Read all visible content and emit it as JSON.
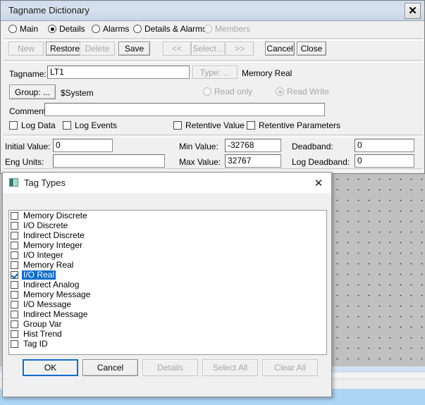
{
  "desktop": {
    "background_color": "#c0c0c0",
    "accent_band_color": "#aed4f5"
  },
  "tagname_window": {
    "title": "Tagname Dictionary",
    "close_label": "✕",
    "view_modes": [
      {
        "label": "Main",
        "selected": false,
        "disabled": false
      },
      {
        "label": "Details",
        "selected": true,
        "disabled": false
      },
      {
        "label": "Alarms",
        "selected": false,
        "disabled": false
      },
      {
        "label": "Details & Alarms",
        "selected": false,
        "disabled": false
      },
      {
        "label": "Members",
        "selected": false,
        "disabled": true
      }
    ],
    "toolbar": [
      {
        "label": "New",
        "disabled": true
      },
      {
        "label": "Restore",
        "disabled": false
      },
      {
        "label": "Delete",
        "disabled": true
      },
      {
        "label": "Save",
        "disabled": false
      },
      {
        "label": "<<",
        "disabled": true
      },
      {
        "label": "Select...",
        "disabled": true
      },
      {
        "label": ">>",
        "disabled": true
      },
      {
        "label": "Cancel",
        "disabled": false
      },
      {
        "label": "Close",
        "disabled": false
      }
    ],
    "fields": {
      "tagname_label": "Tagname:",
      "tagname_value": "LT1",
      "type_button": "Type: ...",
      "type_value": "Memory Real",
      "group_button": "Group: ...",
      "group_value": "$System",
      "access_readonly": "Read only",
      "access_readwrite": "Read Write",
      "comment_label": "Comment:",
      "comment_value": "",
      "log_data": "Log Data",
      "log_events": "Log Events",
      "retentive_value": "Retentive Value",
      "retentive_parameters": "Retentive Parameters",
      "initial_value_label": "Initial Value:",
      "initial_value": "0",
      "eng_units_label": "Eng Units:",
      "eng_units_value": "",
      "min_value_label": "Min Value:",
      "min_value": "-32768",
      "max_value_label": "Max Value:",
      "max_value": "32767",
      "deadband_label": "Deadband:",
      "deadband_value": "0",
      "log_deadband_label": "Log Deadband:",
      "log_deadband_value": "0"
    }
  },
  "tag_types_dialog": {
    "title": "Tag Types",
    "icon": "app-icon",
    "close_label": "✕",
    "items": [
      {
        "label": "Memory Discrete",
        "checked": false,
        "selected": false
      },
      {
        "label": "I/O Discrete",
        "checked": false,
        "selected": false
      },
      {
        "label": "Indirect Discrete",
        "checked": false,
        "selected": false
      },
      {
        "label": "Memory Integer",
        "checked": false,
        "selected": false
      },
      {
        "label": "I/O Integer",
        "checked": false,
        "selected": false
      },
      {
        "label": "Memory Real",
        "checked": false,
        "selected": false
      },
      {
        "label": "I/O Real",
        "checked": true,
        "selected": true
      },
      {
        "label": "Indirect Analog",
        "checked": false,
        "selected": false
      },
      {
        "label": "Memory Message",
        "checked": false,
        "selected": false
      },
      {
        "label": "I/O Message",
        "checked": false,
        "selected": false
      },
      {
        "label": "Indirect Message",
        "checked": false,
        "selected": false
      },
      {
        "label": "Group Var",
        "checked": false,
        "selected": false
      },
      {
        "label": "Hist Trend",
        "checked": false,
        "selected": false
      },
      {
        "label": "Tag ID",
        "checked": false,
        "selected": false
      }
    ],
    "buttons": [
      {
        "label": "OK",
        "disabled": false,
        "focused": true
      },
      {
        "label": "Cancel",
        "disabled": false,
        "focused": false
      },
      {
        "label": "Details",
        "disabled": true,
        "focused": false
      },
      {
        "label": "Select All",
        "disabled": true,
        "focused": false
      },
      {
        "label": "Clear All",
        "disabled": true,
        "focused": false
      }
    ],
    "selection_color": "#0a6ccc"
  }
}
